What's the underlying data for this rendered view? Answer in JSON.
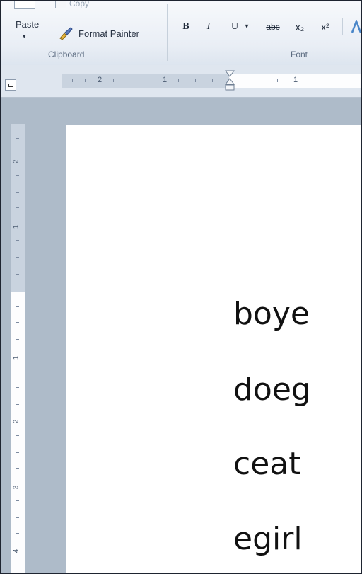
{
  "ribbon": {
    "clipboard": {
      "paste_label": "Paste",
      "paste_arrow": "▾",
      "copy_label": "Copy",
      "format_painter_label": "Format Painter",
      "group_label": "Clipboard"
    },
    "font": {
      "group_label": "Font",
      "bold": "B",
      "italic": "I",
      "underline": "U",
      "underline_arrow": "▾",
      "strikethrough": "abc",
      "subscript": "x₂",
      "superscript": "x²"
    }
  },
  "ruler": {
    "horizontal_numbers": [
      "2",
      "1",
      "1"
    ],
    "vertical_numbers": [
      "2",
      "1",
      "1",
      "2",
      "3",
      "4"
    ]
  },
  "document": {
    "words": [
      "boye",
      "doeg",
      "ceat",
      "egirl"
    ]
  },
  "colors": {
    "ribbon_bg": "#e9eef5",
    "workspace_bg": "#aebbc9",
    "page_bg": "#ffffff",
    "text": "#111111"
  }
}
